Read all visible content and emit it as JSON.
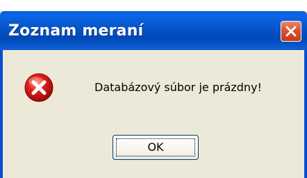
{
  "dialog": {
    "title": "Zoznam meraní",
    "message": "Databázový súbor je prázdny!",
    "ok_label": "OK"
  },
  "icons": {
    "close": "close-icon",
    "error": "error-icon"
  },
  "colors": {
    "titlebar": "#0654c6",
    "close_button": "#d8512e",
    "dialog_background": "#ece9d8",
    "error_icon": "#e0201a"
  }
}
